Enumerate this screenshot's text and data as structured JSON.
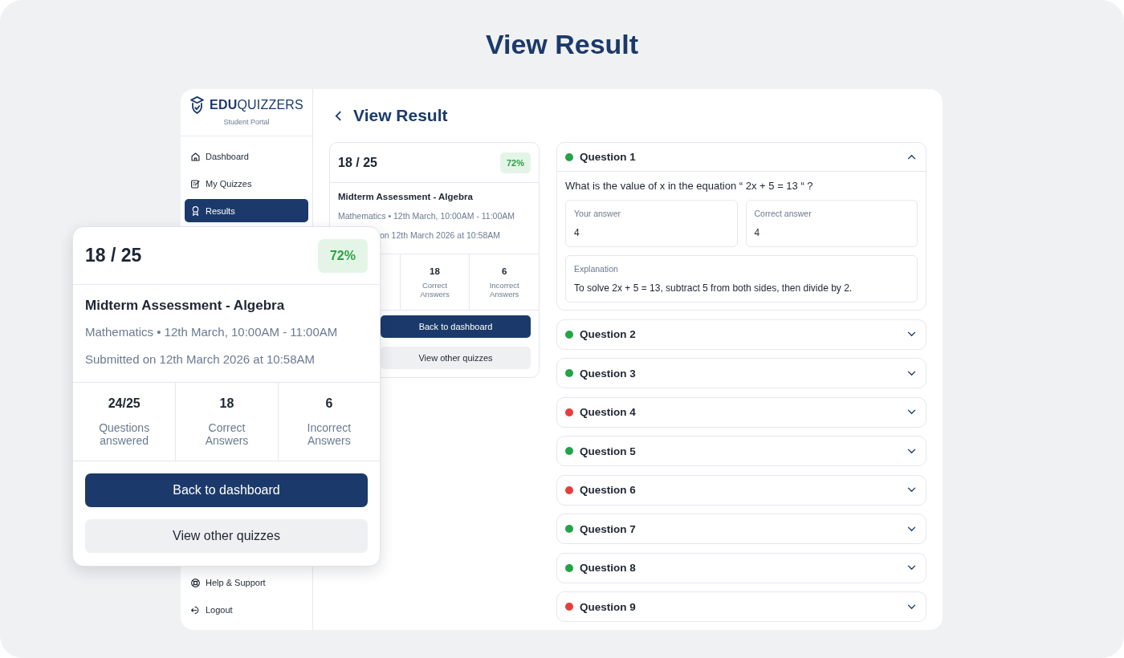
{
  "page_title": "View Result",
  "sidebar": {
    "logo": {
      "strong": "EDU",
      "light": "QUIZZERS"
    },
    "subtitle": "Student Portal",
    "items": [
      {
        "label": "Dashboard",
        "selected": false
      },
      {
        "label": "My Quizzes",
        "selected": false
      },
      {
        "label": "Results",
        "selected": true
      }
    ],
    "footer_items": [
      {
        "label": "Help & Support"
      },
      {
        "label": "Logout"
      }
    ]
  },
  "header": {
    "title": "View Result"
  },
  "summary_card": {
    "score": "18 / 25",
    "percent": "72%",
    "quiz_title": "Midterm Assessment - Algebra",
    "meta": "Mathematics • 12th March, 10:00AM - 11:00AM",
    "submitted": "on 12th March 2026 at 10:58AM",
    "stats": [
      {
        "value": "18",
        "label": "Correct Answers"
      },
      {
        "value": "6",
        "label": "Incorrect Answers"
      }
    ],
    "buttons": [
      {
        "label": "Back to dashboard",
        "kind": "primary"
      },
      {
        "label": "View other quizzes",
        "kind": "secondary"
      }
    ]
  },
  "zoom_card": {
    "score": "18 / 25",
    "percent": "72%",
    "quiz_title": "Midterm Assessment - Algebra",
    "meta": "Mathematics • 12th March, 10:00AM - 11:00AM",
    "submitted": "Submitted on 12th March 2026 at 10:58AM",
    "stats": [
      {
        "value": "24/25",
        "label": "Questions answered"
      },
      {
        "value": "18",
        "label": "Correct Answers"
      },
      {
        "value": "6",
        "label": "Incorrect Answers"
      }
    ],
    "buttons": [
      {
        "label": "Back to dashboard",
        "kind": "primary"
      },
      {
        "label": "View other quizzes",
        "kind": "secondary"
      }
    ]
  },
  "questions": [
    {
      "title": "Question 1",
      "color": "#22a447",
      "expanded": true,
      "text": "What is the value of x in the equation “ 2x + 5 = 13 “ ?",
      "answers": [
        {
          "label": "Your answer",
          "value": "4"
        },
        {
          "label": "Correct answer",
          "value": "4"
        }
      ],
      "explanation": {
        "label": "Explanation",
        "text": "To solve 2x + 5 = 13, subtract 5 from both sides, then divide by 2."
      }
    },
    {
      "title": "Question 2",
      "color": "#22a447",
      "expanded": false
    },
    {
      "title": "Question 3",
      "color": "#22a447",
      "expanded": false
    },
    {
      "title": "Question 4",
      "color": "#e53e3e",
      "expanded": false
    },
    {
      "title": "Question 5",
      "color": "#22a447",
      "expanded": false
    },
    {
      "title": "Question 6",
      "color": "#e53e3e",
      "expanded": false
    },
    {
      "title": "Question 7",
      "color": "#22a447",
      "expanded": false
    },
    {
      "title": "Question 8",
      "color": "#22a447",
      "expanded": false
    },
    {
      "title": "Question 9",
      "color": "#e53e3e",
      "expanded": false
    }
  ]
}
